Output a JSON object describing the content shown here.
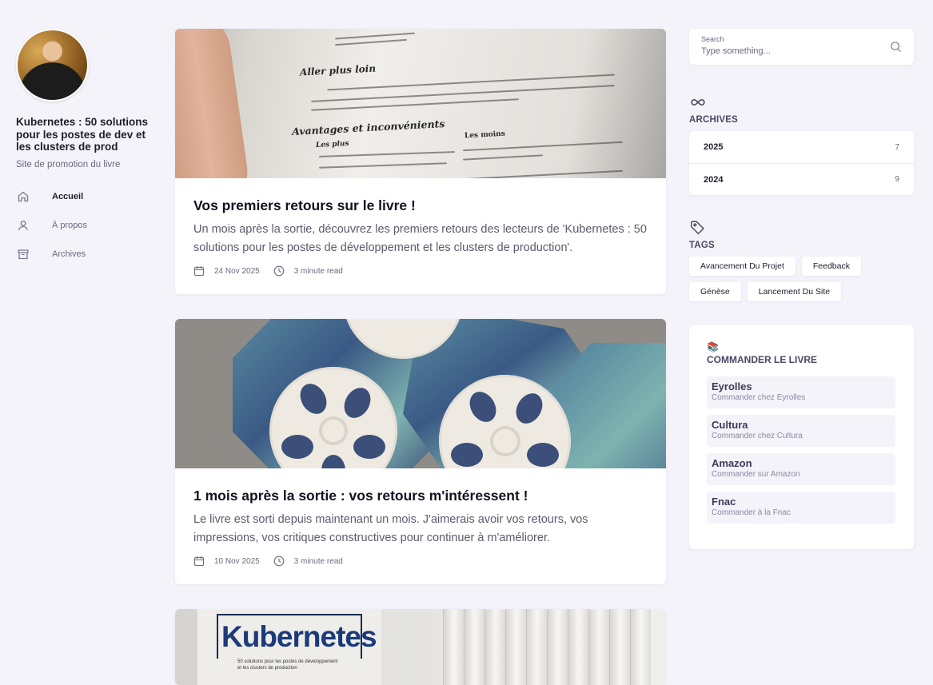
{
  "sidebar": {
    "title": "Kubernetes : 50 solutions pour les postes de dev et les clusters de prod",
    "subtitle": "Site de promotion du livre",
    "nav": [
      {
        "label": "Accueil",
        "icon": "home-icon",
        "active": true
      },
      {
        "label": "À propos",
        "icon": "user-icon",
        "active": false
      },
      {
        "label": "Archives",
        "icon": "archive-icon",
        "active": false
      }
    ]
  },
  "posts": [
    {
      "title": "Vos premiers retours sur le livre !",
      "excerpt": "Un mois après la sortie, découvrez les premiers retours des lecteurs de 'Kubernetes : 50 solutions pour les postes de développement et les clusters de production'.",
      "date": "24 Nov 2025",
      "read_time": "3 minute read",
      "image_text": {
        "heading1": "Aller plus loin",
        "heading2": "Avantages et inconvénients",
        "col_plus": "Les plus",
        "col_moins": "Les moins"
      }
    },
    {
      "title": "1 mois après la sortie : vos retours m'intéressent !",
      "excerpt": "Le livre est sorti depuis maintenant un mois. J'aimerais avoir vos retours, vos impressions, vos critiques constructives pour continuer à m'améliorer.",
      "date": "10 Nov 2025",
      "read_time": "3 minute read"
    },
    {
      "image_text": {
        "cover_title": "Kubernetes",
        "cover_subtitle": "50 solutions pour les postes de développement et les clusters de production"
      }
    }
  ],
  "search": {
    "label": "Search",
    "placeholder": "Type something..."
  },
  "archives": {
    "title": "ARCHIVES",
    "items": [
      {
        "year": "2025",
        "count": "7"
      },
      {
        "year": "2024",
        "count": "9"
      }
    ]
  },
  "tags": {
    "title": "TAGS",
    "items": [
      "Avancement Du Projet",
      "Feedback",
      "Génèse",
      "Lancement Du Site"
    ]
  },
  "order": {
    "emoji": "📚",
    "title": "COMMANDER LE LIVRE",
    "items": [
      {
        "name": "Eyrolles",
        "desc": "Commander chez Eyrolles"
      },
      {
        "name": "Cultura",
        "desc": "Commander chez Cultura"
      },
      {
        "name": "Amazon",
        "desc": "Commander sur Amazon"
      },
      {
        "name": "Fnac",
        "desc": "Commander à la Fnac"
      }
    ]
  }
}
